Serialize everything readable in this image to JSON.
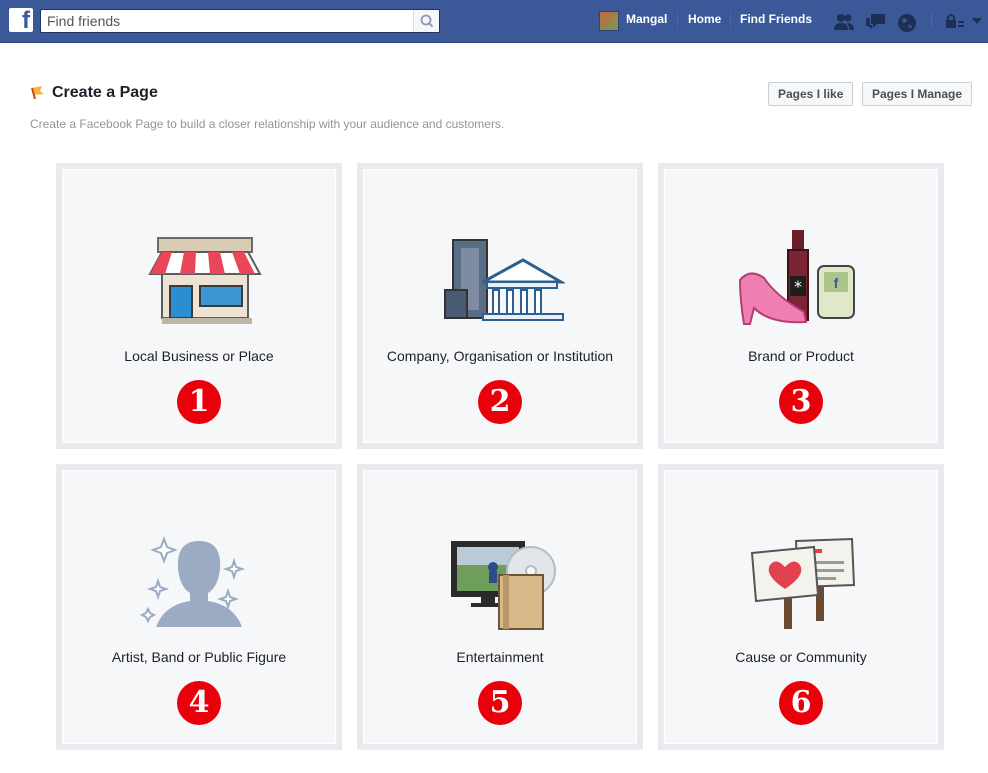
{
  "topbar": {
    "logo": "f",
    "search": {
      "placeholder": "Find friends",
      "value": ""
    },
    "user_name": "Mangal",
    "nav_home": "Home",
    "nav_find_friends": "Find Friends",
    "icons": [
      "friend-requests-icon",
      "messages-icon",
      "notifications-globe-icon",
      "privacy-lock-icon",
      "dropdown-arrow-icon"
    ]
  },
  "header": {
    "title": "Create a Page",
    "subtitle": "Create a Facebook Page to build a closer relationship with your audience and customers.",
    "pages_i_like": "Pages I like",
    "pages_i_manage": "Pages I Manage"
  },
  "categories": [
    {
      "label": "Local Business or Place",
      "number": "1",
      "icon": "storefront-icon"
    },
    {
      "label": "Company, Organisation or Institution",
      "number": "2",
      "icon": "buildings-icon"
    },
    {
      "label": "Brand or Product",
      "number": "3",
      "icon": "products-icon"
    },
    {
      "label": "Artist, Band or Public Figure",
      "number": "4",
      "icon": "public-figure-icon"
    },
    {
      "label": "Entertainment",
      "number": "5",
      "icon": "entertainment-icon"
    },
    {
      "label": "Cause or Community",
      "number": "6",
      "icon": "signs-icon"
    }
  ],
  "colors": {
    "brand": "#3b5998",
    "badge": "#e8000b",
    "card_border": "#e9eaed",
    "card_bg": "#f6f7f9"
  }
}
